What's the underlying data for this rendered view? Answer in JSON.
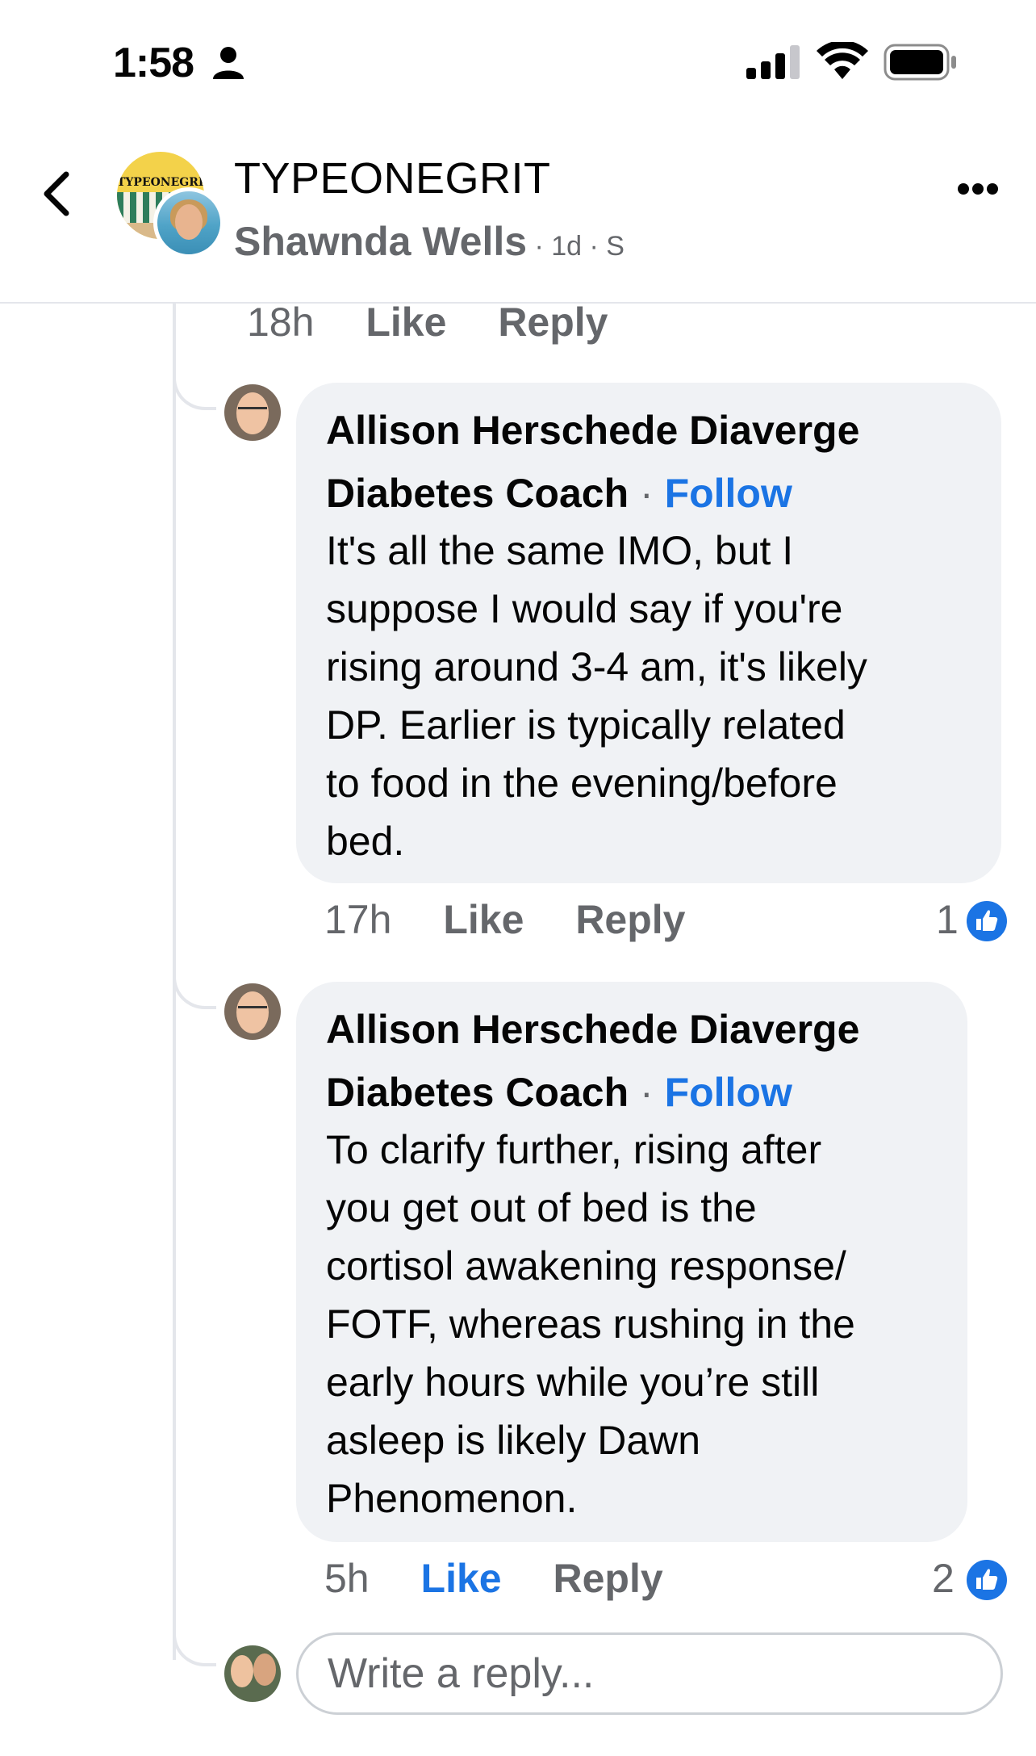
{
  "status_bar": {
    "time": "1:58",
    "icons": [
      "person-icon",
      "cellular-signal-icon",
      "wifi-icon",
      "battery-icon"
    ]
  },
  "header": {
    "back_icon": "chevron-left-icon",
    "group_name": "TYPEONEGRIT",
    "group_avatar_text": "TYPEONEGRIT",
    "author_name": "Shawnda Wells",
    "author_meta": " · 1d · S",
    "more_icon": "more-horizontal-icon"
  },
  "previous_actions": {
    "time": "18h",
    "like": "Like",
    "reply": "Reply"
  },
  "comments": [
    {
      "name_line1": "Allison Herschede Diaverge",
      "name_line2": "Diabetes Coach",
      "dot": " · ",
      "follow": "Follow",
      "text": "It's all the same IMO, but I\nsuppose I would say if you're\nrising around 3-4 am, it's likely\nDP.  Earlier is typically related\nto food in the evening/before\nbed.",
      "time": "17h",
      "like": "Like",
      "reply": "Reply",
      "reactions": "1",
      "liked": false
    },
    {
      "name_line1": "Allison Herschede Diaverge",
      "name_line2": "Diabetes Coach",
      "dot": " · ",
      "follow": "Follow",
      "text": "To clarify further, rising after\nyou get out of bed is the\ncortisol awakening response/\nFOTF, whereas rushing in the\nearly hours while you’re still\nasleep is likely Dawn\nPhenomenon.",
      "time": "5h",
      "like": "Like",
      "reply": "Reply",
      "reactions": "2",
      "liked": true
    }
  ],
  "reply_box": {
    "placeholder": "Write a reply..."
  },
  "colors": {
    "accent": "#1b74e4",
    "secondary_text": "#65676b",
    "bubble": "#f0f2f5"
  }
}
